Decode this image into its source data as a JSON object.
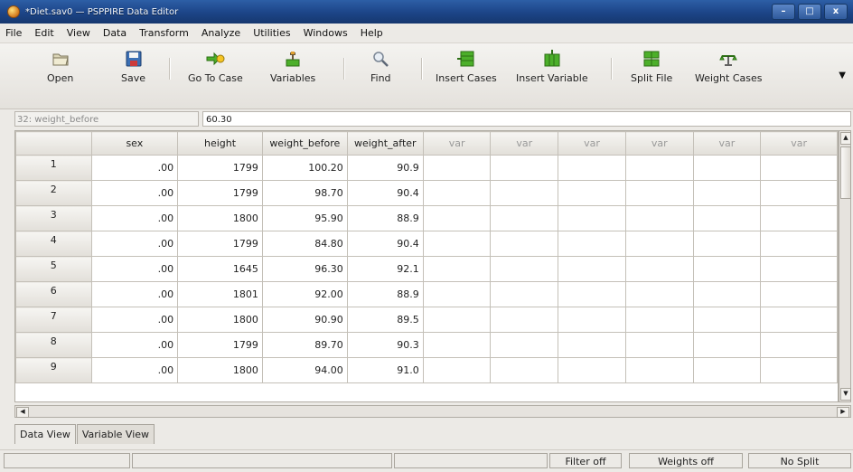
{
  "window": {
    "title": "*Diet.sav0 — PSPPIRE Data Editor"
  },
  "menu": [
    "File",
    "Edit",
    "View",
    "Data",
    "Transform",
    "Analyze",
    "Utilities",
    "Windows",
    "Help"
  ],
  "toolbar": {
    "open": "Open",
    "save": "Save",
    "go_to_case": "Go To Case",
    "variables": "Variables",
    "find": "Find",
    "insert_cases": "Insert Cases",
    "insert_variable": "Insert Variable",
    "split_file": "Split File",
    "weight_cases": "Weight Cases"
  },
  "cell_ref": {
    "name": "32: weight_before",
    "value": "60.30"
  },
  "grid": {
    "columns": [
      "sex",
      "height",
      "weight_before",
      "weight_after",
      "var",
      "var",
      "var",
      "var",
      "var",
      "var"
    ],
    "rows": [
      [
        "1",
        ".00",
        "1799",
        "100.20",
        "90.9"
      ],
      [
        "2",
        ".00",
        "1799",
        "98.70",
        "90.4"
      ],
      [
        "3",
        ".00",
        "1800",
        "95.90",
        "88.9"
      ],
      [
        "4",
        ".00",
        "1799",
        "84.80",
        "90.4"
      ],
      [
        "5",
        ".00",
        "1645",
        "96.30",
        "92.1"
      ],
      [
        "6",
        ".00",
        "1801",
        "92.00",
        "88.9"
      ],
      [
        "7",
        ".00",
        "1800",
        "90.90",
        "89.5"
      ],
      [
        "8",
        ".00",
        "1799",
        "89.70",
        "90.3"
      ],
      [
        "9",
        ".00",
        "1800",
        "94.00",
        "91.0"
      ]
    ]
  },
  "tabs": [
    "Data View",
    "Variable View"
  ],
  "status": {
    "filter": "Filter off",
    "weights": "Weights off",
    "split": "No Split"
  },
  "colors": {
    "titlebar": "#1c4487",
    "accent_green": "#4caf2a"
  }
}
